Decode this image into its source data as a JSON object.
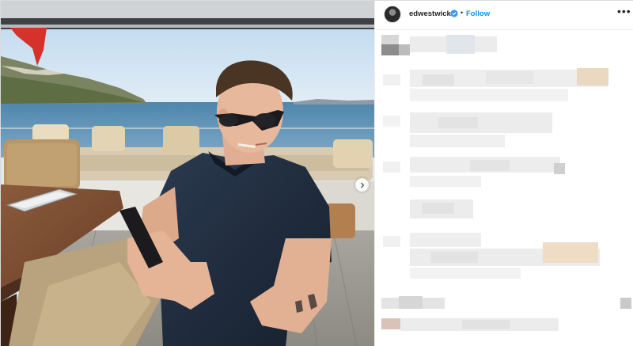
{
  "post": {
    "username": "edwestwick",
    "follow_label": "Follow",
    "separator": "•",
    "more_icon": "more-horizontal-icon",
    "verified_icon": "verified-badge-icon"
  },
  "colors": {
    "follow_blue": "#0095f6",
    "text_dark": "#262626",
    "border": "#dbdbdb",
    "sea": "#5d8fb2",
    "sky": "#cfe3f3",
    "shirt": "#1f2a3a"
  }
}
